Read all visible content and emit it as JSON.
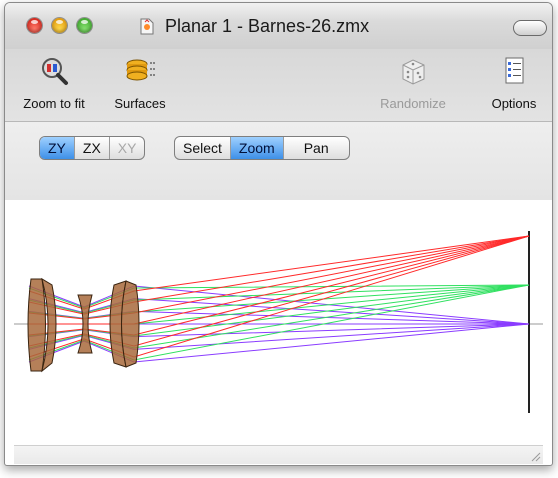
{
  "window": {
    "title": "Planar 1 - Barnes-26.zmx"
  },
  "toolbar": {
    "zoom_to_fit": "Zoom to fit",
    "surfaces": "Surfaces",
    "randomize": "Randomize",
    "options": "Options"
  },
  "view_axes": {
    "zy": "ZY",
    "zx": "ZX",
    "xy": "XY",
    "selected": "ZY"
  },
  "mouse_mode": {
    "select": "Select",
    "zoom": "Zoom",
    "pan": "Pan",
    "selected": "Zoom"
  },
  "colors": {
    "ray_red": "#ff2a2a",
    "ray_green": "#30e060",
    "ray_purple": "#8a3cff",
    "lens_fill": "#a86a3c",
    "selected_blue": "#3e90e8"
  }
}
